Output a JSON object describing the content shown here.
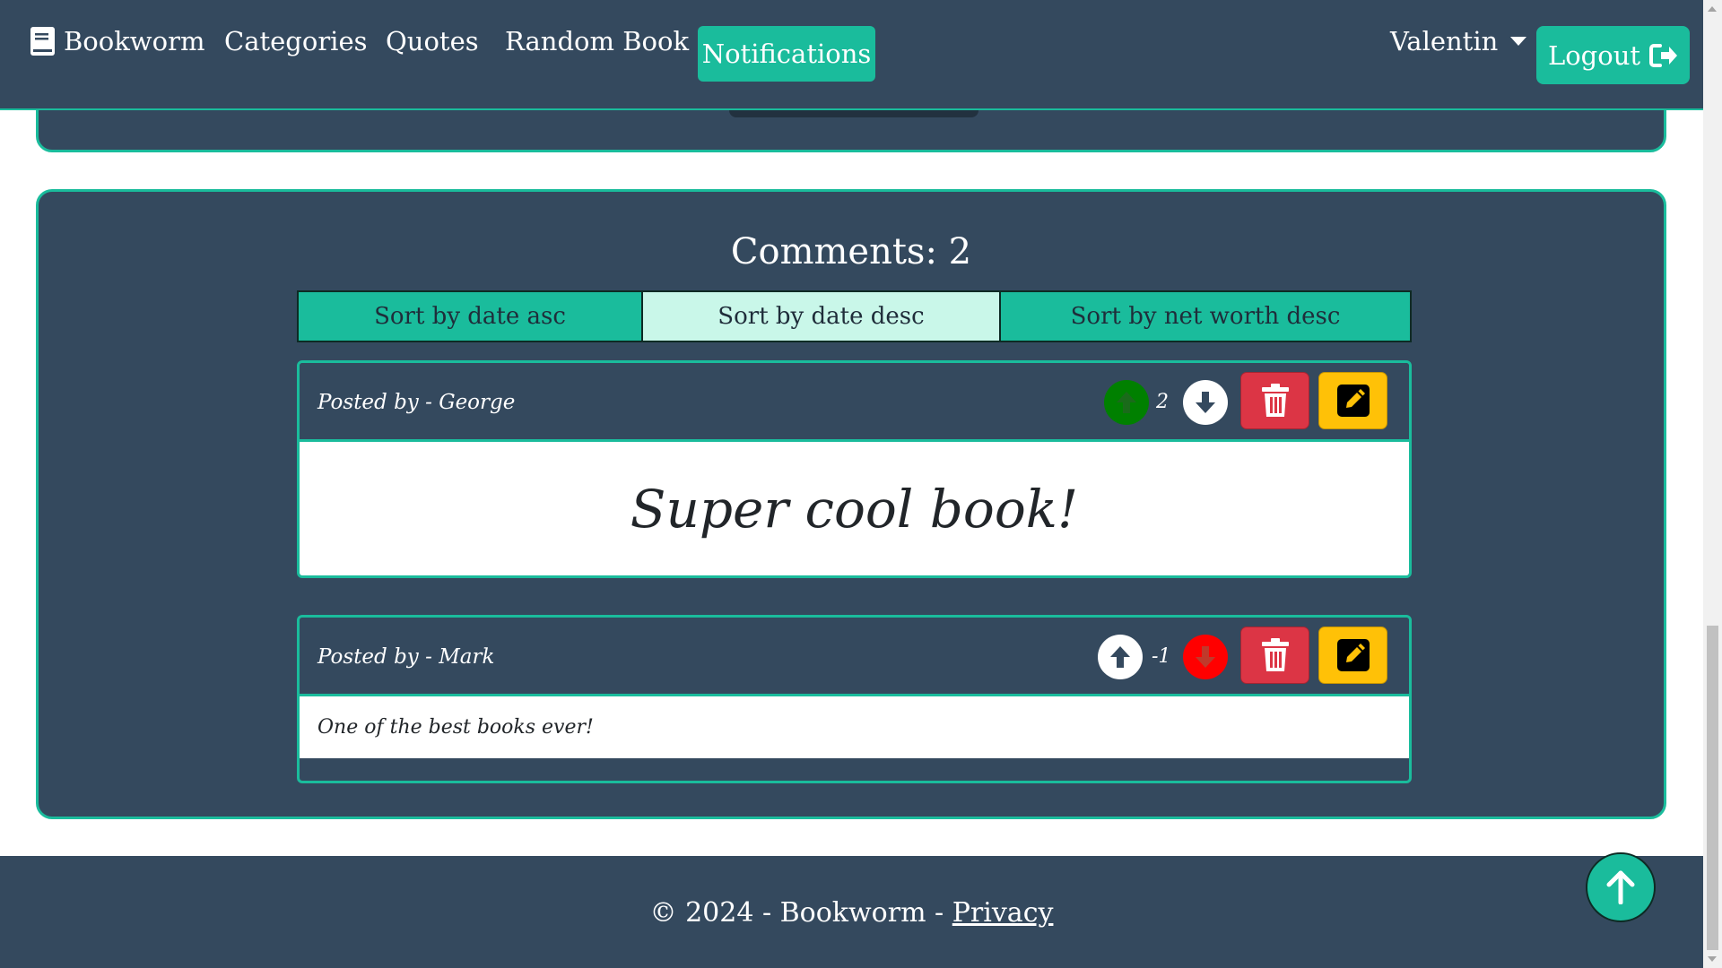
{
  "nav": {
    "brand": "Bookworm",
    "links": [
      "Categories",
      "Quotes",
      "Random Book"
    ],
    "notifications": "Notifications",
    "user": "Valentin",
    "logout": "Logout"
  },
  "comments": {
    "title": "Comments: 2",
    "sort_options": [
      "Sort by date asc",
      "Sort by date desc",
      "Sort by net worth desc"
    ],
    "active_sort": "Sort by date desc",
    "items": [
      {
        "author": "Posted by - George",
        "score": "2",
        "upvoted": true,
        "downvoted": false,
        "text": "Super cool book!"
      },
      {
        "author": "Posted by - Mark",
        "score": "-1",
        "upvoted": false,
        "downvoted": true,
        "text": "One of the best books ever!"
      }
    ]
  },
  "footer": {
    "copyright": "© 2024 - Bookworm - ",
    "privacy": "Privacy"
  },
  "colors": {
    "accent": "#1abc9c",
    "navy": "#34495e",
    "danger": "#dc3545",
    "warning": "#ffc107",
    "upvote_active": "#008000",
    "downvote_active": "#ff0000"
  }
}
